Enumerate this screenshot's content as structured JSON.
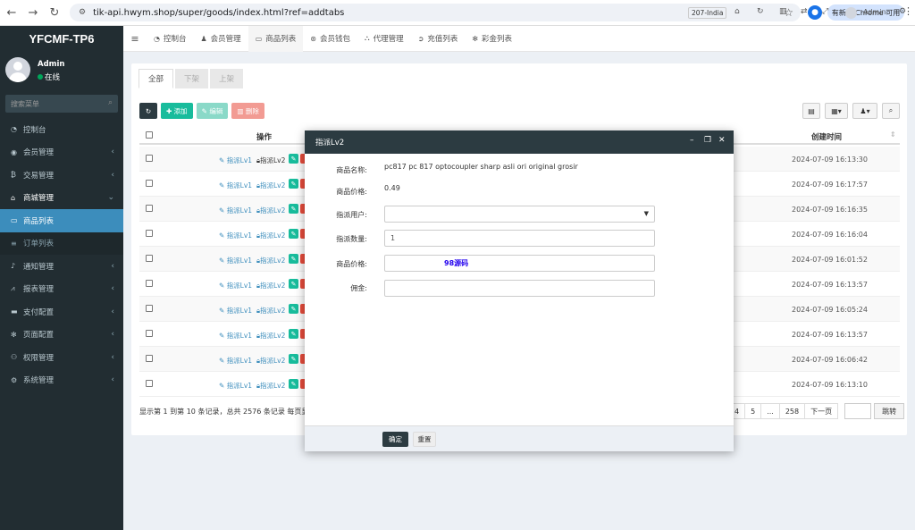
{
  "browser": {
    "url": "tik-api.hwym.shop/super/goods/index.html?ref=addtabs",
    "update_label": "有新版 Chrome 可用"
  },
  "sidebar": {
    "brand": "YFCMF-TP6",
    "user_name": "Admin",
    "user_status": "在线",
    "search_placeholder": "搜索菜单",
    "items": [
      {
        "label": "控制台",
        "icon": "dashboard-icon"
      },
      {
        "label": "会员管理",
        "icon": "user-circle-icon"
      },
      {
        "label": "交易管理",
        "icon": "bitcoin-icon"
      },
      {
        "label": "商城管理",
        "icon": "home-icon"
      },
      {
        "label": "商品列表",
        "icon": "desktop-icon"
      },
      {
        "label": "订单列表",
        "icon": "list-icon"
      },
      {
        "label": "通知管理",
        "icon": "bell-icon"
      },
      {
        "label": "报表管理",
        "icon": "line-chart-icon"
      },
      {
        "label": "支付配置",
        "icon": "credit-card-icon"
      },
      {
        "label": "页面配置",
        "icon": "gear-icon"
      },
      {
        "label": "权限管理",
        "icon": "users-icon"
      },
      {
        "label": "系统管理",
        "icon": "cogs-icon"
      }
    ]
  },
  "topnav": {
    "tabs": [
      "控制台",
      "会员管理",
      "商品列表",
      "会员钱包",
      "代理管理",
      "充值列表",
      "彩金列表"
    ],
    "region": "207-India",
    "admin": "Admin"
  },
  "content": {
    "tabs": [
      "全部",
      "下架",
      "上架"
    ],
    "toolbar": {
      "add": "添加",
      "edit": "编辑",
      "delete": "删除"
    },
    "columns": {
      "op": "操作",
      "created": "创建时间"
    },
    "actions": {
      "lv1": "指派Lv1",
      "lv2": "指派Lv2"
    },
    "rows": [
      {
        "created": "2024-07-09 16:13:30"
      },
      {
        "created": "2024-07-09 16:17:57"
      },
      {
        "created": "2024-07-09 16:16:35"
      },
      {
        "created": "2024-07-09 16:16:04"
      },
      {
        "created": "2024-07-09 16:01:52"
      },
      {
        "created": "2024-07-09 16:13:57"
      },
      {
        "created": "2024-07-09 16:05:24"
      },
      {
        "created": "2024-07-09 16:13:57"
      },
      {
        "created": "2024-07-09 16:06:42"
      },
      {
        "created": "2024-07-09 16:13:10"
      }
    ],
    "footer_text": "显示第 1 到第 10 条记录，总共 2576 条记录 每页显示",
    "pager": [
      "4",
      "5",
      "...",
      "258",
      "下一页"
    ],
    "jump": "跳转"
  },
  "modal": {
    "title": "指派Lv2",
    "fields": {
      "name_label": "商品名称:",
      "name_value": "pc817 pc 817 optocoupler sharp asli ori original grosir",
      "price_label": "商品价格:",
      "price_value": "0.49",
      "user_label": "指派用户:",
      "qty_label": "指派数量:",
      "qty_value": "1",
      "price2_label": "商品价格:",
      "price2_hint": "98源码",
      "commission_label": "佣金:"
    },
    "ok": "确定",
    "reset": "重置"
  }
}
